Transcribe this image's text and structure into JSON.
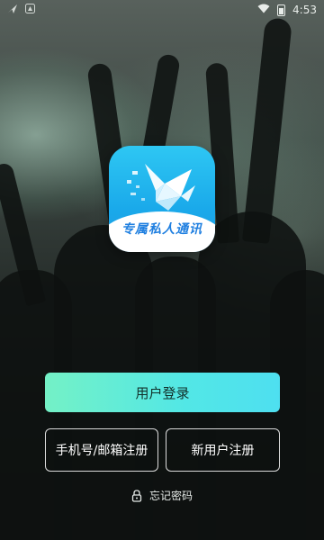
{
  "status_bar": {
    "time": "4:53",
    "left_icons": [
      "navigation-icon",
      "notification-icon"
    ],
    "right_icons": [
      "wifi-icon",
      "battery-icon"
    ]
  },
  "logo": {
    "icon": "paper-crane-icon",
    "text": "专属私人通讯",
    "colors": {
      "primary": "#1ea9ec",
      "band": "#ffffff",
      "text": "#1f7fe0"
    }
  },
  "buttons": {
    "login": "用户登录",
    "phone_email_register": "手机号/邮箱注册",
    "new_user_register": "新用户注册"
  },
  "forgot": {
    "icon": "lock-icon",
    "label": "忘记密码"
  },
  "colors": {
    "login_gradient_start": "#74f1c6",
    "login_gradient_end": "#4edff0"
  }
}
